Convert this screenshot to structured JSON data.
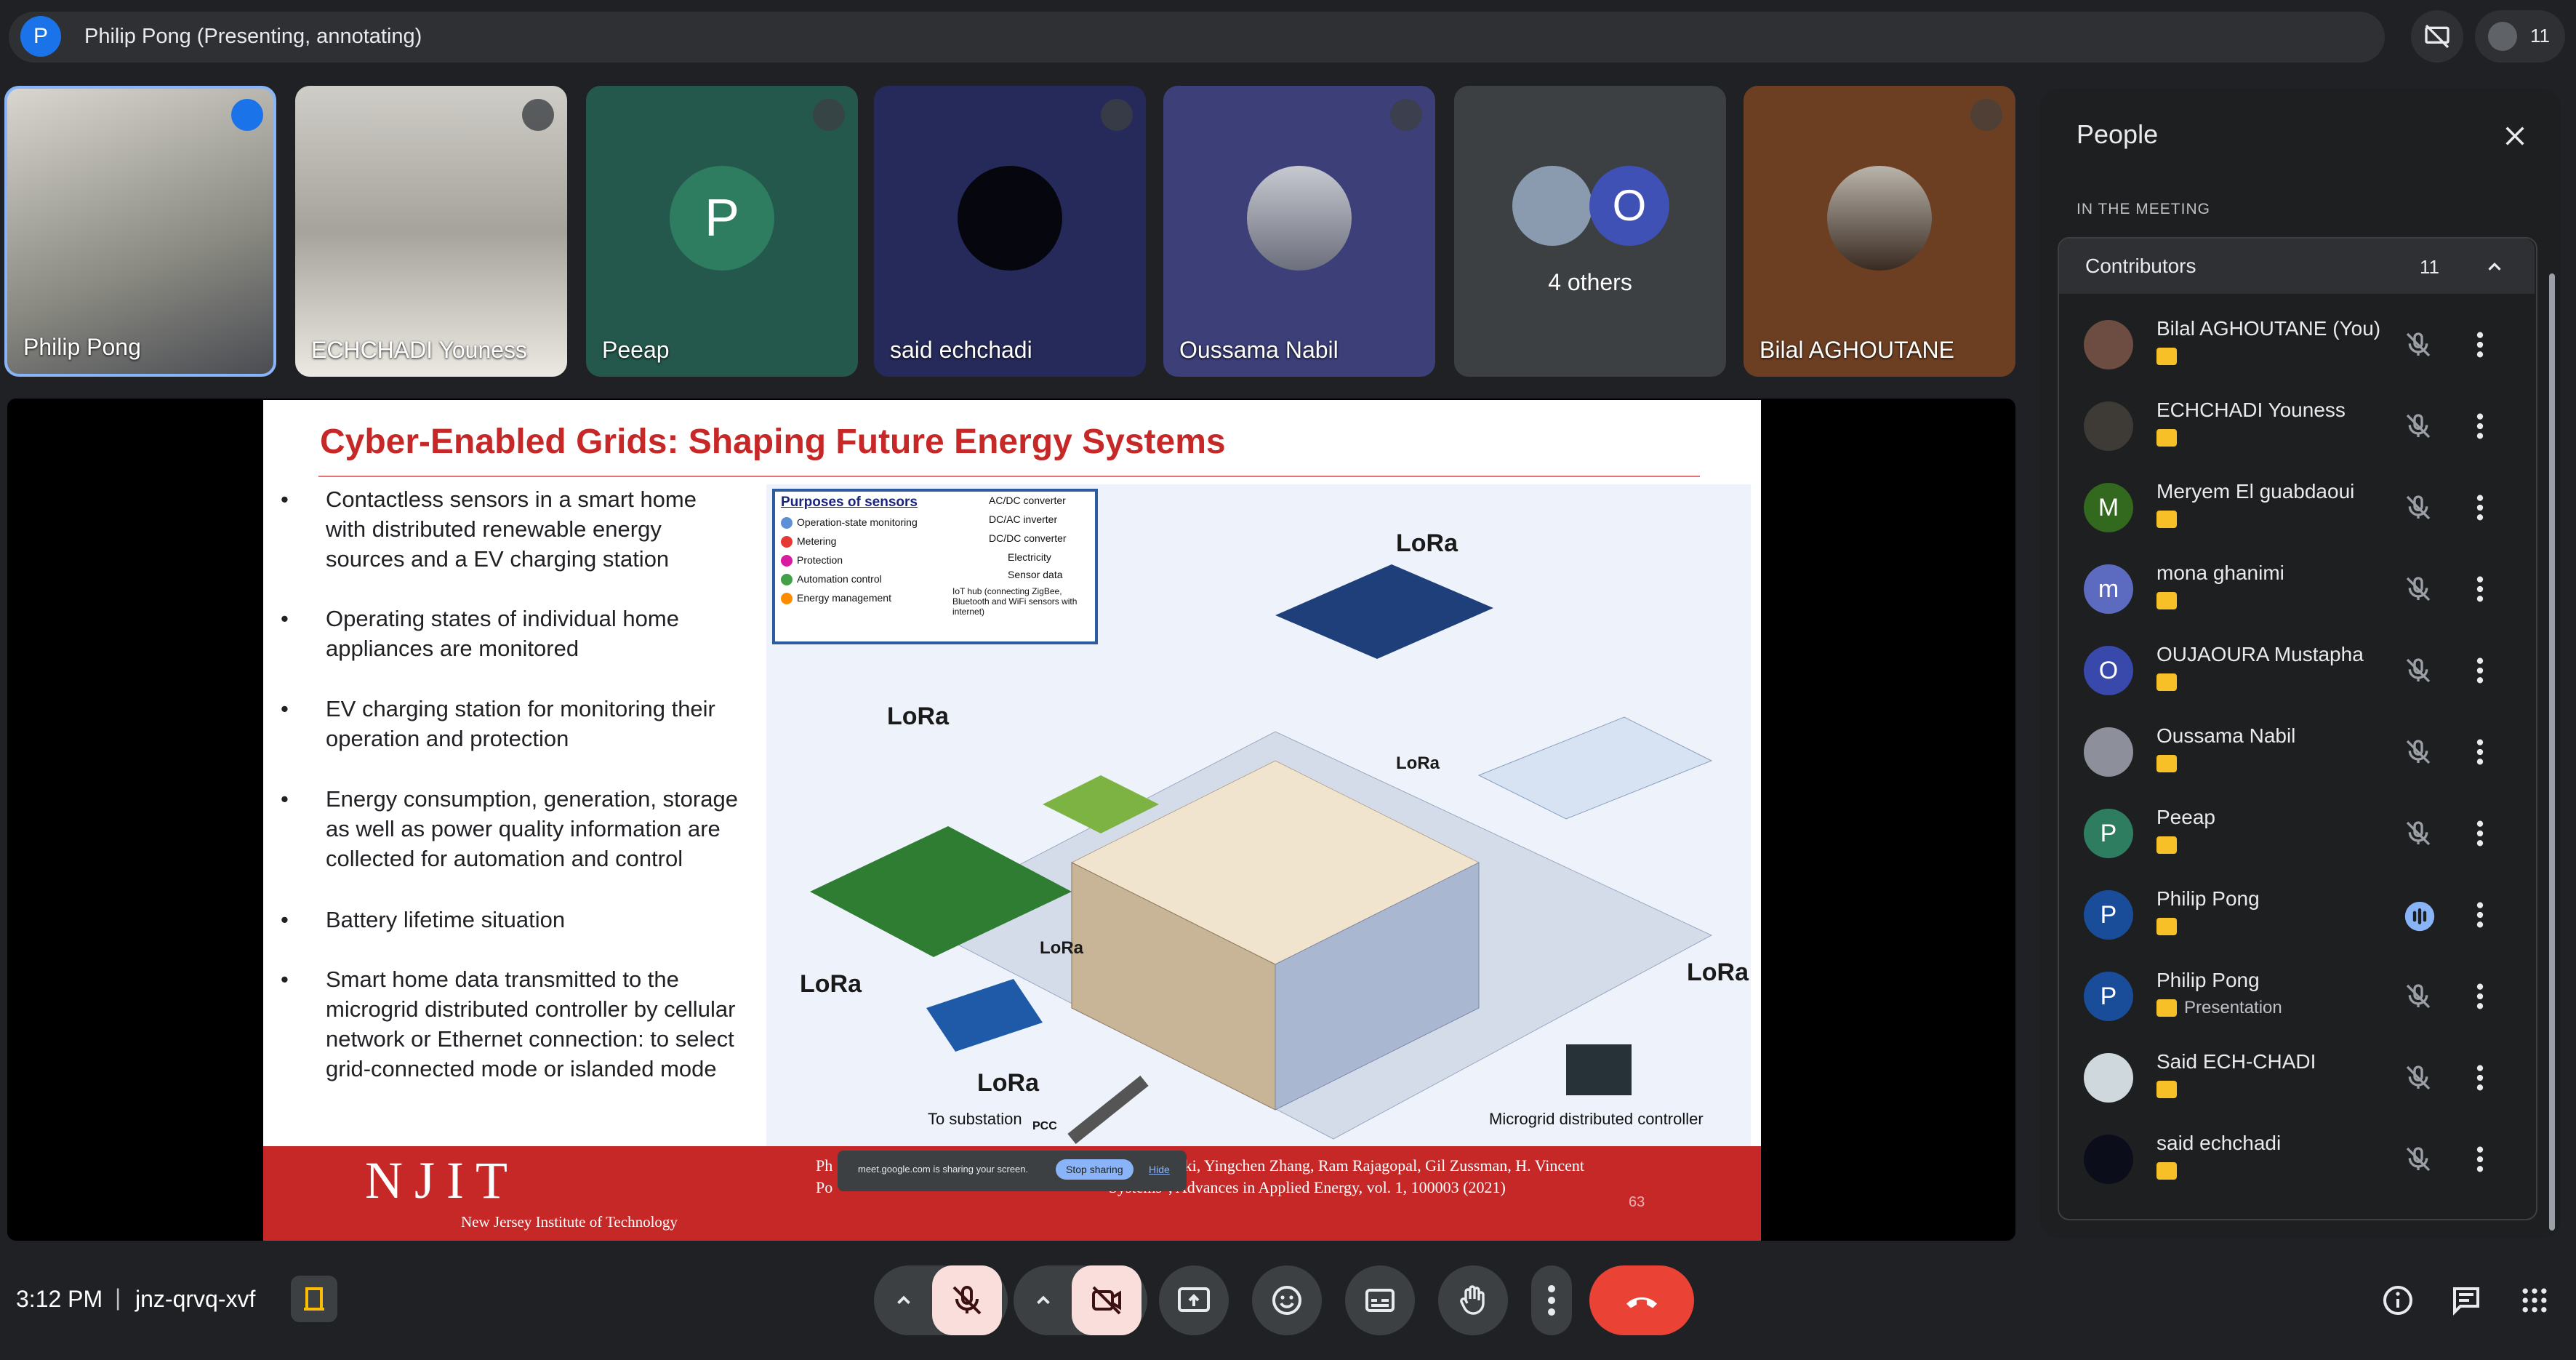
{
  "header": {
    "presenter_initial": "P",
    "presenter_text": "Philip Pong (Presenting, annotating)",
    "participant_count": "11"
  },
  "tiles": [
    {
      "name": "Philip Pong"
    },
    {
      "name": "ECHCHADI Youness"
    },
    {
      "name": "Peeap",
      "initial": "P"
    },
    {
      "name": "said echchadi"
    },
    {
      "name": "Oussama Nabil"
    },
    {
      "name": "4 others",
      "initial": "O"
    },
    {
      "name": "Bilal AGHOUTANE"
    }
  ],
  "slide": {
    "title": "Cyber-Enabled Grids: Shaping Future Energy Systems",
    "bullets": [
      "Contactless sensors in a smart home with distributed renewable energy sources and a EV charging station",
      "Operating states of individual home appliances are monitored",
      "EV charging station for monitoring their operation and protection",
      "Energy consumption, generation, storage as well as power quality information are collected for automation and control",
      "Battery lifetime situation",
      "Smart home data transmitted to the microgrid distributed controller by cellular network or Ethernet connection: to select grid-connected mode or islanded mode"
    ],
    "legend_title": "Purposes of sensors",
    "legend_items": [
      "Operation-state monitoring",
      "Metering",
      "Protection",
      "Automation control",
      "Energy management"
    ],
    "legend_right": [
      "AC/DC converter",
      "DC/AC inverter",
      "DC/DC converter",
      "Electricity",
      "Sensor data",
      "IoT hub (connecting ZigBee, Bluetooth and WiFi sensors with internet)"
    ],
    "lora": "LoRa",
    "to_substation": "To substation",
    "pcc": "PCC",
    "controller": "Microgrid distributed controller",
    "logo": "NJIT",
    "logo_sub": "New Jersey Institute of Technology",
    "citation_line1": "Ph                                                                        in Kroposki, Yingchen Zhang, Ram Rajagopal, Gil Zussman, H. Vincent",
    "citation_line2": "Po                                                                     Systems\", Advances in Applied Energy, vol. 1, 100003 (2021)",
    "page_number": "63",
    "share_notice": "meet.google.com is sharing your screen.",
    "stop_sharing": "Stop sharing",
    "hide": "Hide"
  },
  "bottom": {
    "time": "3:12 PM",
    "separator": "|",
    "meeting_code": "jnz-qrvq-xvf"
  },
  "people": {
    "title": "People",
    "section": "IN THE MEETING",
    "group_label": "Contributors",
    "group_count": "11",
    "list": [
      {
        "name": "Bilal AGHOUTANE (You)",
        "initial": "",
        "color": "#6d4c41",
        "sub": ""
      },
      {
        "name": "ECHCHADI Youness",
        "initial": "",
        "color": "#3e3a36",
        "sub": ""
      },
      {
        "name": "Meryem El guabdaoui",
        "initial": "M",
        "color": "#33691e",
        "sub": ""
      },
      {
        "name": "mona ghanimi",
        "initial": "m",
        "color": "#5c6bc0",
        "sub": ""
      },
      {
        "name": "OUJAOURA Mustapha",
        "initial": "O",
        "color": "#3949ab",
        "sub": ""
      },
      {
        "name": "Oussama Nabil",
        "initial": "",
        "color": "#8d8f9a",
        "sub": ""
      },
      {
        "name": "Peeap",
        "initial": "P",
        "color": "#2e7d61",
        "sub": ""
      },
      {
        "name": "Philip Pong",
        "initial": "P",
        "color": "#1a4d99",
        "sub": ""
      },
      {
        "name": "Philip Pong",
        "initial": "P",
        "color": "#1a4d99",
        "sub": "Presentation"
      },
      {
        "name": "Said ECH-CHADI",
        "initial": "",
        "color": "#cfd8dc",
        "sub": ""
      },
      {
        "name": "said echchadi",
        "initial": "",
        "color": "#0b0d1a",
        "sub": ""
      }
    ]
  }
}
